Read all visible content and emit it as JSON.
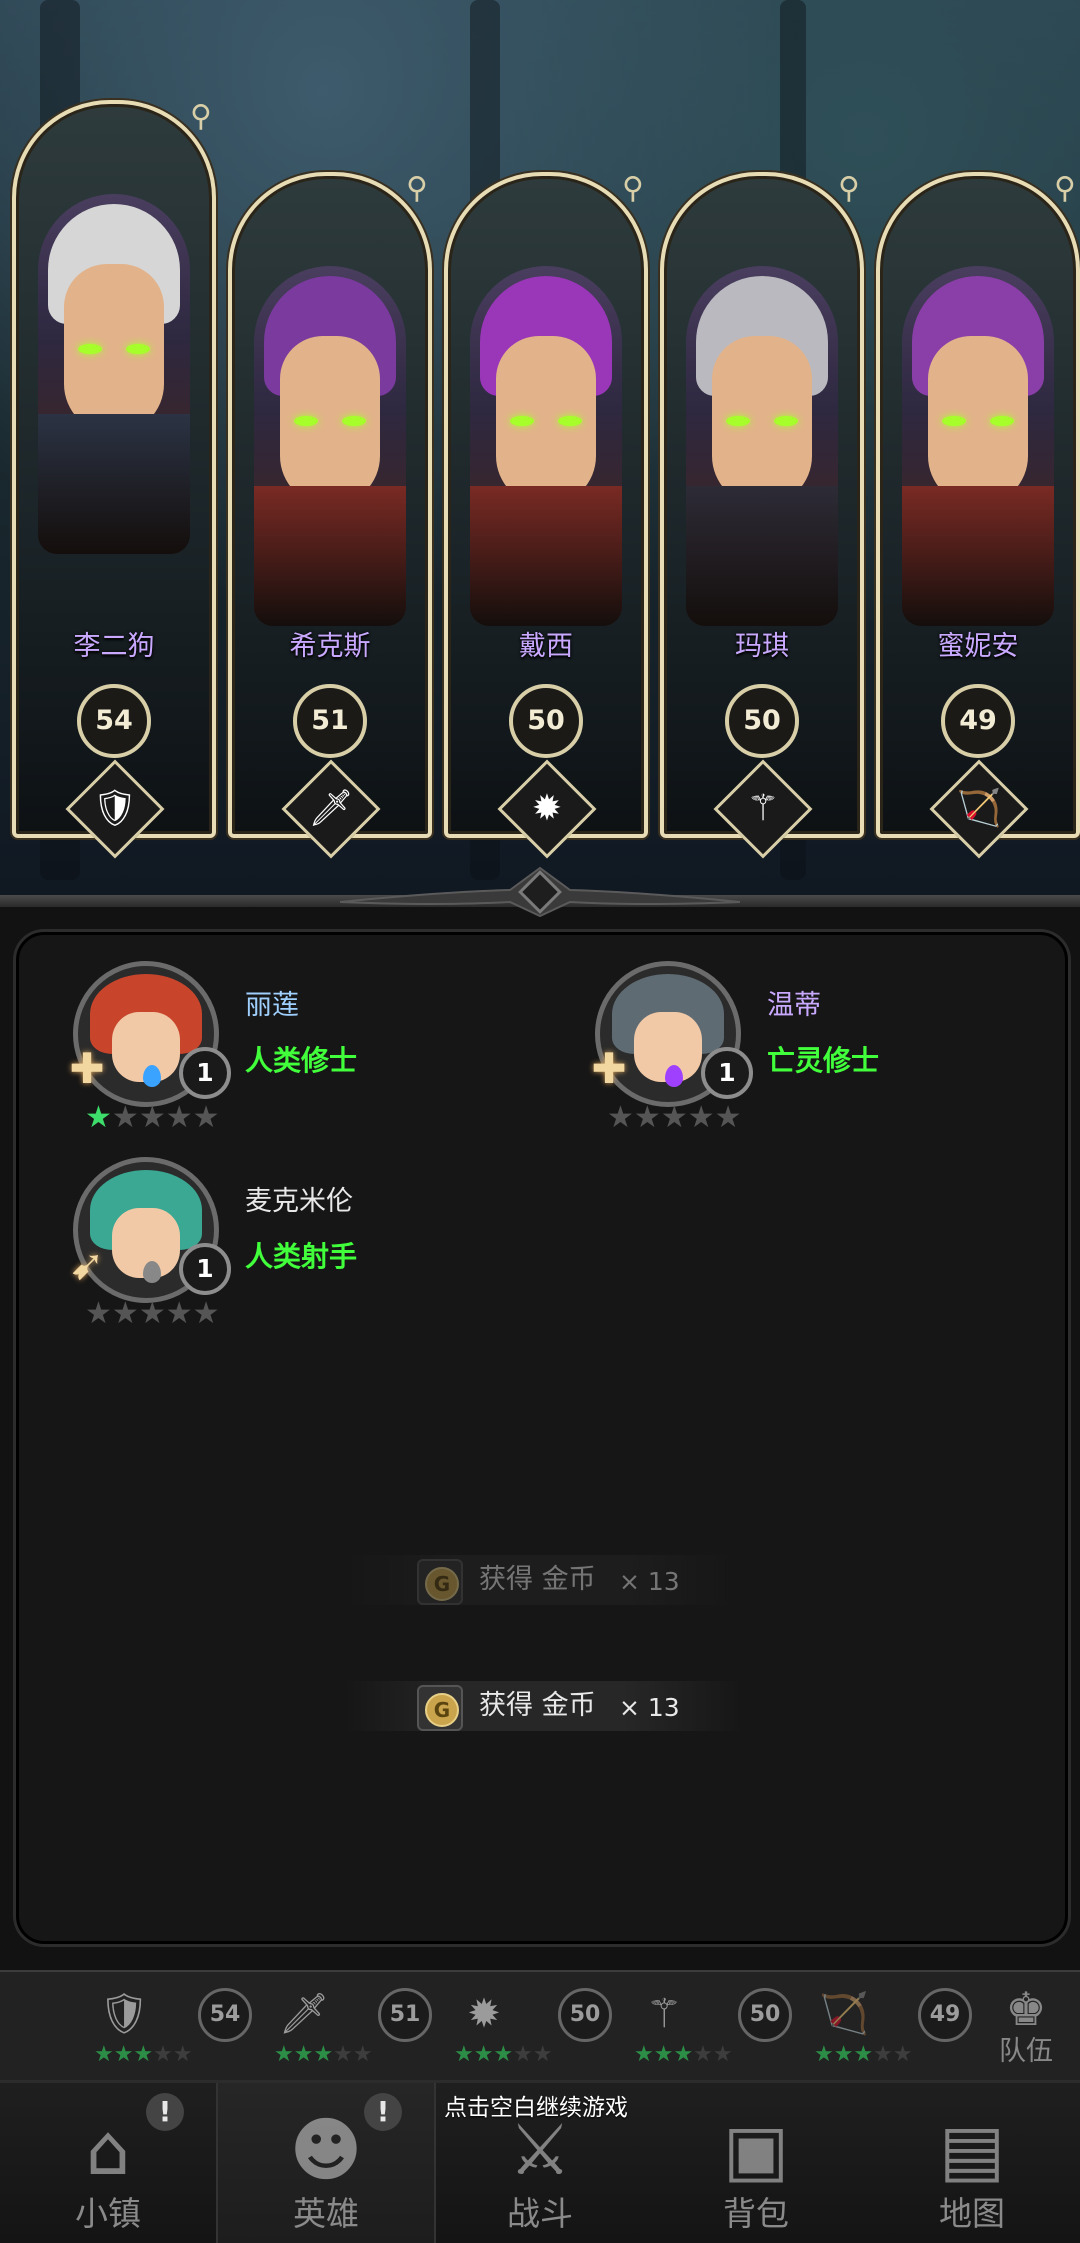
{
  "top_heroes": [
    {
      "name": "李二狗",
      "level": "54",
      "class_icon": "shield-icon",
      "hair": "#d6d6d6",
      "armor": "#2b3344"
    },
    {
      "name": "希克斯",
      "level": "51",
      "class_icon": "dagger-icon",
      "hair": "#7a3a9e",
      "armor": "#7a2a24"
    },
    {
      "name": "戴西",
      "level": "50",
      "class_icon": "holy-emblem-icon",
      "hair": "#9a36b8",
      "armor": "#7a2a24"
    },
    {
      "name": "玛琪",
      "level": "50",
      "class_icon": "staff-icon",
      "hair": "#b9b9bf",
      "armor": "#2d2b36"
    },
    {
      "name": "蜜妮安",
      "level": "49",
      "class_icon": "bow-icon",
      "hair": "#8a3fa8",
      "armor": "#7a2a24"
    }
  ],
  "hero_list": [
    {
      "name": "丽莲",
      "type": "人类修士",
      "level": "1",
      "stars_on": 1,
      "stars_total": 5,
      "name_color": "#9fd0ff",
      "hair": "#c8452c",
      "gem": "#3aa2ff",
      "class_icon": "holy-cross-icon"
    },
    {
      "name": "温蒂",
      "type": "亡灵修士",
      "level": "1",
      "stars_on": 0,
      "stars_total": 5,
      "name_color": "#c9a9ff",
      "hair": "#5f6b72",
      "gem": "#a040ff",
      "class_icon": "holy-cross-icon"
    },
    {
      "name": "麦克米伦",
      "type": "人类射手",
      "level": "1",
      "stars_on": 0,
      "stars_total": 5,
      "name_color": "#e8e8e8",
      "hair": "#3aa893",
      "gem": "#888888",
      "class_icon": "crossbow-icon"
    }
  ],
  "rewards": [
    {
      "text": "获得 金币",
      "qty": "× 13",
      "opacity": 0.45
    },
    {
      "text": "获得 金币",
      "qty": "× 13",
      "opacity": 1.0
    }
  ],
  "coin_glyph": "G",
  "team_strip": [
    {
      "level": "54",
      "icon": "shield-icon"
    },
    {
      "level": "51",
      "icon": "dagger-icon"
    },
    {
      "level": "50",
      "icon": "holy-emblem-icon"
    },
    {
      "level": "50",
      "icon": "staff-icon"
    },
    {
      "level": "49",
      "icon": "bow-icon"
    }
  ],
  "team_button": {
    "label": "队伍"
  },
  "nav": [
    {
      "label": "小镇",
      "icon": "town-icon",
      "alert": "!",
      "active": false
    },
    {
      "label": "英雄",
      "icon": "hero-icon",
      "alert": "!",
      "active": true
    },
    {
      "label": "战斗",
      "icon": "swords-icon",
      "alert": "",
      "active": false
    },
    {
      "label": "背包",
      "icon": "backpack-icon",
      "alert": "",
      "active": false
    },
    {
      "label": "地图",
      "icon": "map-icon",
      "alert": "",
      "active": false
    }
  ],
  "hint_text": "点击空白继续游戏",
  "colors": {
    "gold_frame": "#e8dcb4",
    "hero_name": "#c9a9ff",
    "type_green": "#41ff3b",
    "star_green": "#3ddc6b"
  }
}
